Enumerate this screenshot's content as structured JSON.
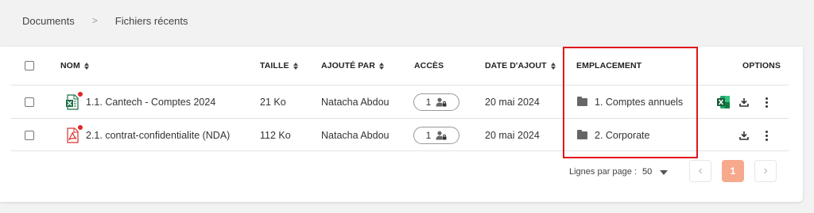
{
  "breadcrumb": {
    "items": [
      "Documents",
      "Fichiers récents"
    ],
    "separator": ">"
  },
  "table": {
    "headers": {
      "nom": "NOM",
      "taille": "TAILLE",
      "ajoute_par": "AJOUTÉ PAR",
      "acces": "ACCÈS",
      "date_ajout": "DATE D'AJOUT",
      "emplacement": "EMPLACEMENT",
      "options": "OPTIONS"
    },
    "rows": [
      {
        "nom": "1.1. Cantech - Comptes 2024",
        "file_type": "excel-icon",
        "taille": "21 Ko",
        "ajoute_par": "Natacha Abdou",
        "acces": "1",
        "date_ajout": "20 mai 2024",
        "emplacement": "1.  Comptes annuels",
        "has_excel_action": true
      },
      {
        "nom": "2.1. contrat-confidentialite (NDA)",
        "file_type": "pdf-icon",
        "taille": "112 Ko",
        "ajoute_par": "Natacha Abdou",
        "acces": "1",
        "date_ajout": "20 mai 2024",
        "emplacement": "2.  Corporate",
        "has_excel_action": false
      }
    ]
  },
  "pagination": {
    "rows_per_page_label": "Lignes par page :",
    "rows_per_page_value": "50",
    "current_page": "1"
  },
  "colors": {
    "highlight_box": "#e3141b",
    "excel_green": "#1d7044",
    "pdf_red": "#d9342b",
    "notification_badge": "#e3242b",
    "active_page": "#f7a98c"
  }
}
